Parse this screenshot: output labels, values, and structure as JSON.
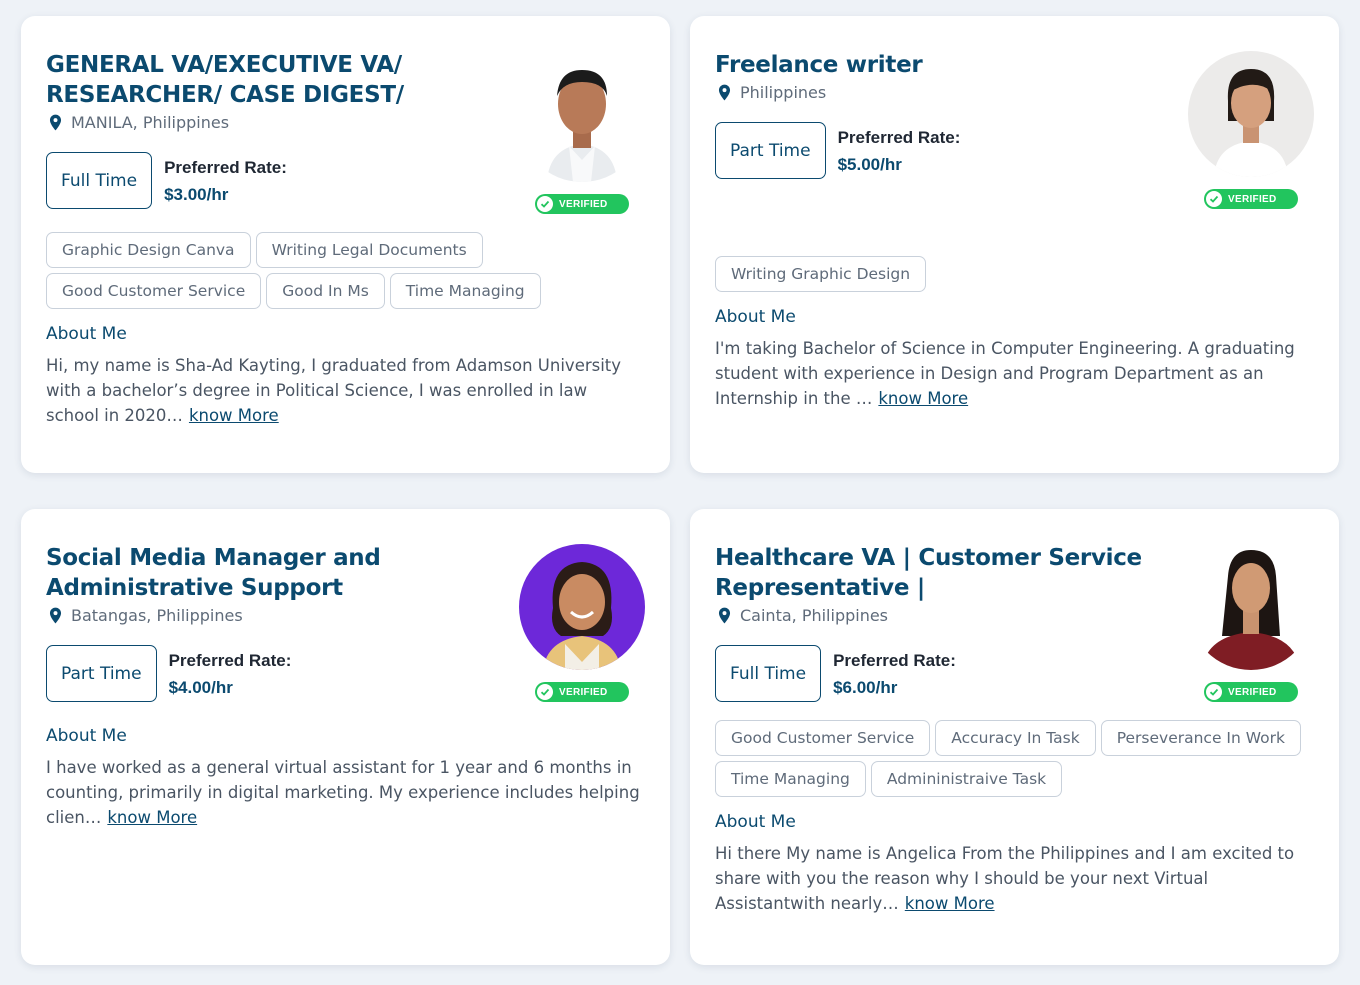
{
  "common": {
    "preferred_rate_label": "Preferred Rate:",
    "about_label": "About Me",
    "know_more_label": "know More",
    "verified_label": "VERIFIED",
    "verified_color": "#22c55e",
    "accent_color": "#0b4a6f"
  },
  "cards": [
    {
      "title": "GENERAL VA/EXECUTIVE VA/ RESEARCHER/ CASE DIGEST/",
      "location": "MANILA, Philippines",
      "employment_type": "Full Time",
      "rate": "$3.00/hr",
      "skills": [
        "Graphic Design Canva",
        "Writing Legal Documents",
        "Good Customer Service",
        "Good In Ms",
        "Time Managing"
      ],
      "about": "Hi, my name is Sha-Ad Kayting, I graduated from Adamson University with a bachelor’s degree in Political Science, I was enrolled in law school in 2020…",
      "avatar": "man-light-background"
    },
    {
      "title": "Freelance writer",
      "location": "Philippines",
      "employment_type": "Part Time",
      "rate": "$5.00/hr",
      "skills": [
        "Writing Graphic Design"
      ],
      "about": "I'm taking Bachelor of Science in Computer Engineering. A graduating student with experience in Design and Program Department as an Internship in the …",
      "avatar": "woman-white-blouse"
    },
    {
      "title": "Social Media Manager and Administrative Support",
      "location": "Batangas, Philippines",
      "employment_type": "Part Time",
      "rate": "$4.00/hr",
      "skills": [],
      "about": "I have worked as a general virtual assistant for 1 year and 6 months in counting, primarily in digital marketing. My experience includes helping clien…",
      "avatar": "woman-purple-background"
    },
    {
      "title": "Healthcare VA | Customer Service Representative |",
      "location": "Cainta, Philippines",
      "employment_type": "Full Time",
      "rate": "$6.00/hr",
      "skills": [
        "Good Customer Service",
        "Accuracy In Task",
        "Perseverance In Work",
        "Time Managing",
        "Admininistraive Task"
      ],
      "about": "Hi there My name is Angelica From the Philippines and I am excited to share with you the reason why I should be your next Virtual Assistantwith nearly…",
      "avatar": "woman-red-top"
    }
  ]
}
